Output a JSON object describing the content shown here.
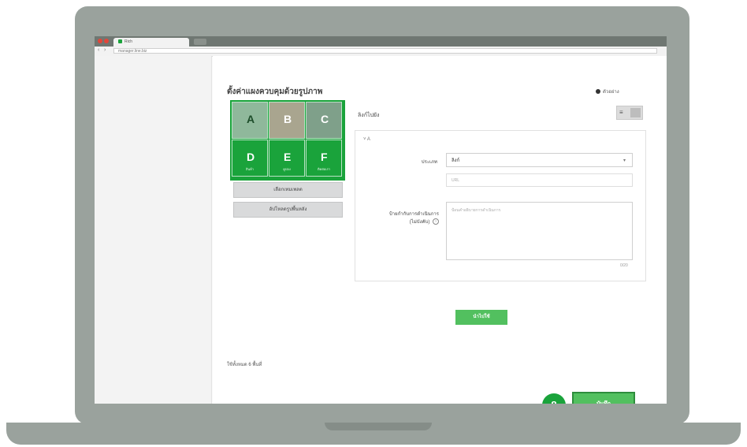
{
  "browser": {
    "tab_title": "Rich",
    "url": "manager.line.biz"
  },
  "page": {
    "title": "ตั้งค่าแผงควบคุมด้วยรูปภาพ",
    "radio_label": "ตัวอย่าง",
    "section_label": "ลิงก์ไปยัง"
  },
  "template_grid": {
    "cells": [
      {
        "letter": "A",
        "caption": ""
      },
      {
        "letter": "B",
        "caption": ""
      },
      {
        "letter": "C",
        "caption": ""
      },
      {
        "letter": "D",
        "caption": "สินค้า"
      },
      {
        "letter": "E",
        "caption": "คูปอง"
      },
      {
        "letter": "F",
        "caption": "ติดต่อเรา"
      }
    ]
  },
  "side_buttons": {
    "select_template": "เลือกเทมเพลต",
    "upload_image": "อัปโหลดรูปพื้นหลัง"
  },
  "form": {
    "collapse_label": "A",
    "type_label": "ประเภท",
    "type_value": "ลิงก์",
    "url_placeholder": "URL",
    "action_label": "ป้ายกำกับการดำเนินการ",
    "action_label_2": "(ไม่บังคับ)",
    "action_placeholder": "ป้อนคำอธิบายการดำเนินการ",
    "counter": "0/20"
  },
  "buttons": {
    "apply": "นำไปใช้",
    "save": "บันทึก"
  },
  "footer": {
    "text": "ใช้ทั้งหมด 6 พื้นที่"
  },
  "step": {
    "number": "8"
  },
  "colors": {
    "accent": "#52c05f",
    "brand_green": "#1aa33b",
    "frame": "#9aa29d"
  }
}
